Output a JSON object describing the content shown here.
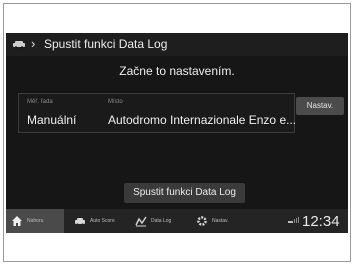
{
  "header": {
    "title": "Spustit funkci Data Log",
    "back_icon": "chevron-right-icon",
    "app_icon": "car-app-icon"
  },
  "message": "Začne to nastavením.",
  "settings": {
    "gear_label": "Měř. řada",
    "gear_value": "Manuální",
    "place_label": "Místo",
    "place_value": "Autodromo Internazionale Enzo e...",
    "set_button": "Nastav."
  },
  "start_button": "Spustit funkci Data Log",
  "bottom_nav": {
    "items": [
      {
        "label": "Nahoru",
        "icon": "home-icon"
      },
      {
        "label": "Auto Score",
        "icon": "car-icon"
      },
      {
        "label": "Data Log",
        "icon": "data-log-icon"
      },
      {
        "label": "Nastav.",
        "icon": "gear-icon"
      }
    ],
    "clock": "12:34"
  },
  "colors": {
    "screen_bg": "#161616",
    "button_bg": "#4b4b4b",
    "active_tab_bg": "#4a4a4a"
  }
}
